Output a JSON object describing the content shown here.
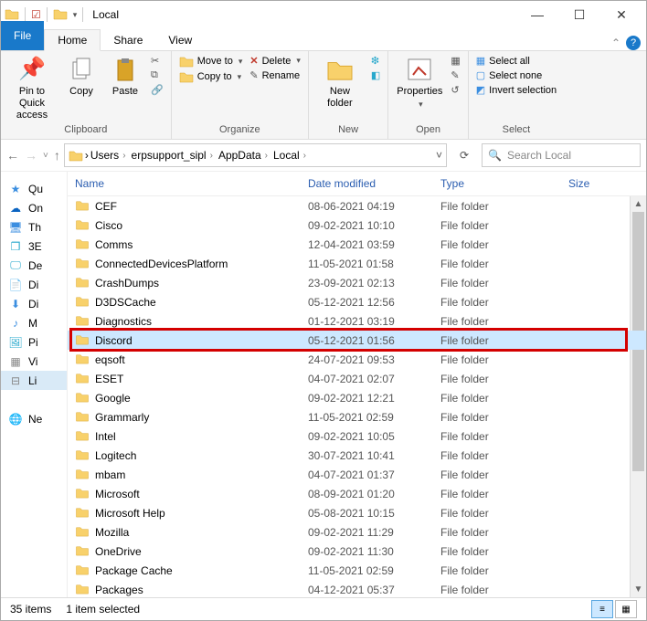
{
  "window": {
    "title": "Local"
  },
  "tabs": {
    "file": "File",
    "home": "Home",
    "share": "Share",
    "view": "View"
  },
  "ribbon": {
    "clipboard": {
      "pin": "Pin to Quick access",
      "copy": "Copy",
      "paste": "Paste",
      "label": "Clipboard"
    },
    "organize": {
      "move": "Move to",
      "copy": "Copy to",
      "delete": "Delete",
      "rename": "Rename",
      "label": "Organize"
    },
    "new": {
      "newfolder": "New folder",
      "label": "New"
    },
    "open": {
      "properties": "Properties",
      "label": "Open"
    },
    "select": {
      "all": "Select all",
      "none": "Select none",
      "invert": "Invert selection",
      "label": "Select"
    }
  },
  "breadcrumb": {
    "parts": [
      "Users",
      "erpsupport_sipl",
      "AppData",
      "Local"
    ]
  },
  "search": {
    "placeholder": "Search Local"
  },
  "sidebar": {
    "items": [
      {
        "icon": "star",
        "color": "#3b8ee0",
        "label": "Qu"
      },
      {
        "icon": "cloud",
        "color": "#0a63c1",
        "label": "On"
      },
      {
        "icon": "pc",
        "color": "#3b8ee0",
        "label": "Th"
      },
      {
        "icon": "cube",
        "color": "#27a8cc",
        "label": "3E"
      },
      {
        "icon": "desk",
        "color": "#27a8cc",
        "label": "De"
      },
      {
        "icon": "doc",
        "color": "#666",
        "label": "Di"
      },
      {
        "icon": "down",
        "color": "#3b8ee0",
        "label": "Di"
      },
      {
        "icon": "music",
        "color": "#3b8ee0",
        "label": "M"
      },
      {
        "icon": "pic",
        "color": "#27a8cc",
        "label": "Pi"
      },
      {
        "icon": "vid",
        "color": "#888",
        "label": "Vi"
      },
      {
        "icon": "drive",
        "color": "#888",
        "label": "Li",
        "selected": true
      },
      {
        "icon": "",
        "label": ""
      },
      {
        "icon": "net",
        "color": "#3b8ee0",
        "label": "Ne"
      }
    ]
  },
  "columns": {
    "name": "Name",
    "date": "Date modified",
    "type": "Type",
    "size": "Size"
  },
  "file_type": "File folder",
  "items": [
    {
      "name": "CEF",
      "date": "08-06-2021 04:19"
    },
    {
      "name": "Cisco",
      "date": "09-02-2021 10:10"
    },
    {
      "name": "Comms",
      "date": "12-04-2021 03:59"
    },
    {
      "name": "ConnectedDevicesPlatform",
      "date": "11-05-2021 01:58"
    },
    {
      "name": "CrashDumps",
      "date": "23-09-2021 02:13"
    },
    {
      "name": "D3DSCache",
      "date": "05-12-2021 12:56"
    },
    {
      "name": "Diagnostics",
      "date": "01-12-2021 03:19"
    },
    {
      "name": "Discord",
      "date": "05-12-2021 01:56",
      "selected": true
    },
    {
      "name": "eqsoft",
      "date": "24-07-2021 09:53"
    },
    {
      "name": "ESET",
      "date": "04-07-2021 02:07"
    },
    {
      "name": "Google",
      "date": "09-02-2021 12:21"
    },
    {
      "name": "Grammarly",
      "date": "11-05-2021 02:59"
    },
    {
      "name": "Intel",
      "date": "09-02-2021 10:05"
    },
    {
      "name": "Logitech",
      "date": "30-07-2021 10:41"
    },
    {
      "name": "mbam",
      "date": "04-07-2021 01:37"
    },
    {
      "name": "Microsoft",
      "date": "08-09-2021 01:20"
    },
    {
      "name": "Microsoft Help",
      "date": "05-08-2021 10:15"
    },
    {
      "name": "Mozilla",
      "date": "09-02-2021 11:29"
    },
    {
      "name": "OneDrive",
      "date": "09-02-2021 11:30"
    },
    {
      "name": "Package Cache",
      "date": "11-05-2021 02:59"
    },
    {
      "name": "Packages",
      "date": "04-12-2021 05:37"
    }
  ],
  "status": {
    "count": "35 items",
    "selected": "1 item selected"
  }
}
